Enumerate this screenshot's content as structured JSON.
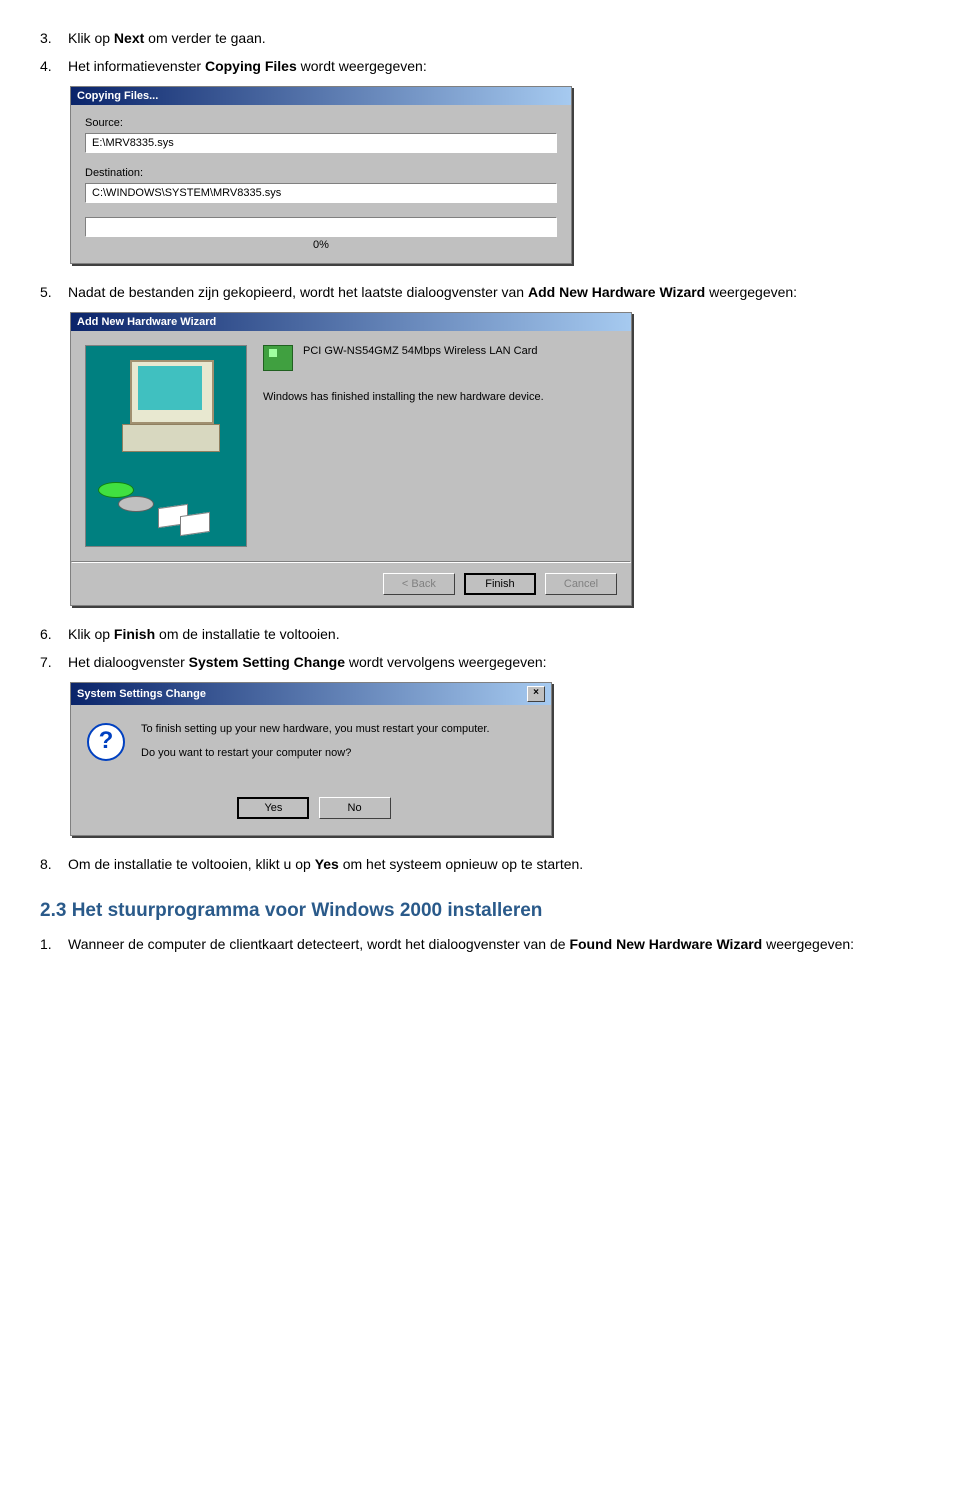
{
  "steps": {
    "s3": {
      "num": "3.",
      "pre": "Klik op ",
      "bold": "Next",
      "post": " om verder te gaan."
    },
    "s4": {
      "num": "4.",
      "pre": "Het informatievenster ",
      "bold": "Copying Files",
      "post": " wordt weergegeven:"
    },
    "s5": {
      "num": "5.",
      "pre": "Nadat de bestanden zijn gekopieerd, wordt het laatste dialoogvenster van ",
      "bold": "Add New Hardware Wizard",
      "post": " weergegeven:"
    },
    "s6": {
      "num": "6.",
      "pre": "Klik op ",
      "bold": "Finish",
      "post": " om de installatie te voltooien."
    },
    "s7": {
      "num": "7.",
      "pre": "Het dialoogvenster ",
      "bold": "System Setting Change",
      "post": " wordt vervolgens weergegeven:"
    },
    "s8": {
      "num": "8.",
      "pre": "Om de installatie te voltooien, klikt u op ",
      "bold": "Yes",
      "post": " om het systeem opnieuw op te starten."
    }
  },
  "section23": {
    "num": "1.",
    "title": "2.3 Het stuurprogramma voor Windows 2000 installeren",
    "text_pre": "Wanneer de computer de clientkaart detecteert, wordt het dialoogvenster van de ",
    "text_bold": "Found New Hardware Wizard",
    "text_post": " weergegeven:"
  },
  "copying": {
    "title": "Copying Files...",
    "source_label": "Source:",
    "source_value": "E:\\MRV8335.sys",
    "dest_label": "Destination:",
    "dest_value": "C:\\WINDOWS\\SYSTEM\\MRV8335.sys",
    "progress": "0%"
  },
  "wizard": {
    "title": "Add New Hardware Wizard",
    "device": "PCI GW-NS54GMZ 54Mbps Wireless LAN Card",
    "message": "Windows has finished installing the new hardware device.",
    "back": "< Back",
    "finish": "Finish",
    "cancel": "Cancel"
  },
  "syschange": {
    "title": "System Settings Change",
    "line1": "To finish setting up your new hardware, you must restart your computer.",
    "line2": "Do you want to restart your computer now?",
    "yes": "Yes",
    "no": "No",
    "close": "×"
  }
}
